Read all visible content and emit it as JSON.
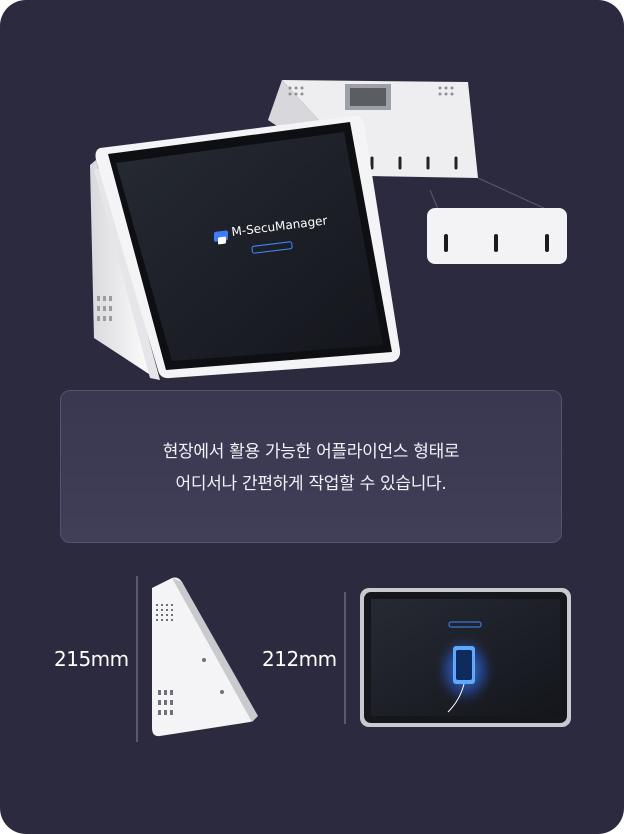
{
  "hero": {
    "screen_logo_text": "M-SecuManager"
  },
  "caption": {
    "line1": "현장에서 활용 가능한 어플라이언스 형태로",
    "line2": "어디서나 간편하게 작업할 수 있습니다."
  },
  "dimensions": {
    "height_label": "215mm",
    "width_label": "212mm"
  },
  "colors": {
    "background": "#2c2a3e",
    "caption_box": "#3d3b54",
    "device_body": "#f2f2f4",
    "screen": "#1c1f26",
    "accent": "#3d8bff"
  }
}
